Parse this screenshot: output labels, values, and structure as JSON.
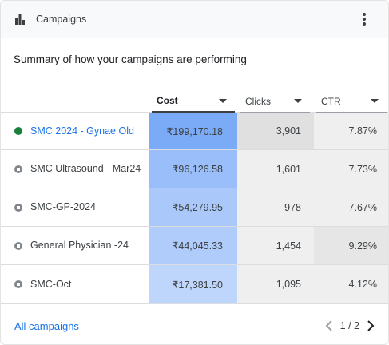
{
  "header": {
    "title": "Campaigns",
    "icon": "bar-chart-icon",
    "menu_icon": "more-vert-icon"
  },
  "summary": "Summary of how your campaigns are performing",
  "columns": [
    {
      "label": "Cost",
      "sorted": true
    },
    {
      "label": "Clicks",
      "sorted": false
    },
    {
      "label": "CTR",
      "sorted": false
    }
  ],
  "rows": [
    {
      "name": "SMC 2024 - Gynae Old",
      "status": "active",
      "cost": "₹199,170.18",
      "clicks": "3,901",
      "ctr": "7.87%",
      "cost_value": 199170.18,
      "clicks_value": 3901,
      "ctr_value": 7.87
    },
    {
      "name": "SMC Ultrasound - Mar24",
      "status": "paused",
      "cost": "₹96,126.58",
      "clicks": "1,601",
      "ctr": "7.73%",
      "cost_value": 96126.58,
      "clicks_value": 1601,
      "ctr_value": 7.73
    },
    {
      "name": "SMC-GP-2024",
      "status": "paused",
      "cost": "₹54,279.95",
      "clicks": "978",
      "ctr": "7.67%",
      "cost_value": 54279.95,
      "clicks_value": 978,
      "ctr_value": 7.67
    },
    {
      "name": "General Physician -24",
      "status": "paused",
      "cost": "₹44,045.33",
      "clicks": "1,454",
      "ctr": "9.29%",
      "cost_value": 44045.33,
      "clicks_value": 1454,
      "ctr_value": 9.29
    },
    {
      "name": "SMC-Oct",
      "status": "paused",
      "cost": "₹17,381.50",
      "clicks": "1,095",
      "ctr": "4.12%",
      "cost_value": 17381.5,
      "clicks_value": 1095,
      "ctr_value": 4.12
    }
  ],
  "footer": {
    "all_link": "All campaigns",
    "pagination": "1 / 2"
  },
  "colors": {
    "link": "#1a73e8",
    "active_status": "#188038",
    "paused_status": "#80868b",
    "heat_max": "#7baaf7",
    "heat_min": "#d2e3fc",
    "clicks_top": "#e0e0e0",
    "neutral_cell": "#efefef"
  }
}
